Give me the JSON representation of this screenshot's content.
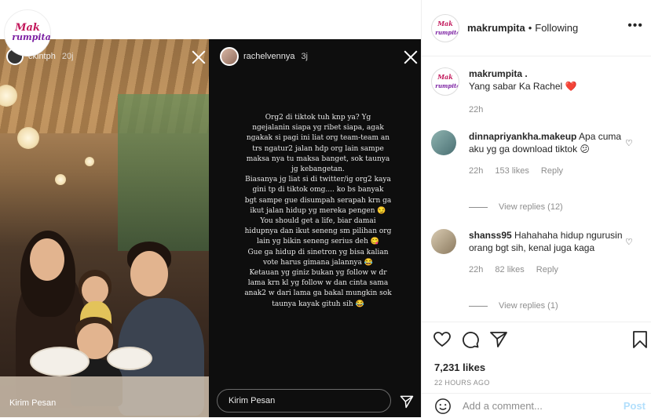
{
  "account_logo": {
    "line1": "Mak",
    "line2": "rumpita"
  },
  "story1": {
    "username": "ckintph",
    "time": "20j",
    "reply_placeholder": "Kirim Pesan"
  },
  "story2": {
    "username": "rachelvennya",
    "time": "3j",
    "text": "Org2 di tiktok tuh knp ya? Yg\nngejalanin siapa yg ribet siapa, agak\nngakak si pagi ini liat org team-team an\ntrs ngatur2 jalan hdp org lain sampe\nmaksa nya tu maksa banget, sok taunya\njg kebangetan.\nBiasanya jg liat si di twitter/ig org2 kaya\ngini tp di tiktok omg.... ko bs banyak\nbgt sampe gue disumpah serapah krn ga\nikut jalan hidup yg mereka pengen 😏\nYou should get a life, biar damai\nhidupnya dan ikut seneng sm pilihan org\nlain yg bikin seneng serius deh 😋\nGue ga hidup di sinetron yg bisa kalian\nvote harus gimana jalannya 😂\nKetauan yg giniz bukan yg follow w dr\nlama krn kl yg follow w dan cinta sama\nanak2 w dari lama ga bakal mungkin sok\ntaunya kayak gituh sih 😂",
    "reply_placeholder": "Kirim Pesan"
  },
  "header": {
    "username": "makrumpita",
    "separator": "•",
    "follow_status": "Following",
    "more": "•••"
  },
  "caption": {
    "username": "makrumpita .",
    "text": "Yang sabar Ka Rachel",
    "emoji": "❤️",
    "time": "22h"
  },
  "comments": [
    {
      "username": "dinnapriyankha.makeup",
      "text": "Apa cuma aku yg ga download tiktok 😕",
      "time": "22h",
      "likes": "153 likes",
      "reply": "Reply",
      "view_replies": "View replies (12)"
    },
    {
      "username": "shanss95",
      "text": "Hahahaha hidup ngurusin orang bgt sih, kenal juga kaga",
      "time": "22h",
      "likes": "82 likes",
      "reply": "Reply",
      "view_replies": "View replies (1)"
    }
  ],
  "stats": {
    "likes": "7,231 likes",
    "ago": "22 HOURS AGO"
  },
  "add_comment": {
    "placeholder": "Add a comment...",
    "post_label": "Post"
  },
  "colors": {
    "brand_pink": "#c2185b",
    "brand_purple": "#7b1fa2",
    "post_disabled": "#b2dffc",
    "muted": "#8e8e8e"
  }
}
